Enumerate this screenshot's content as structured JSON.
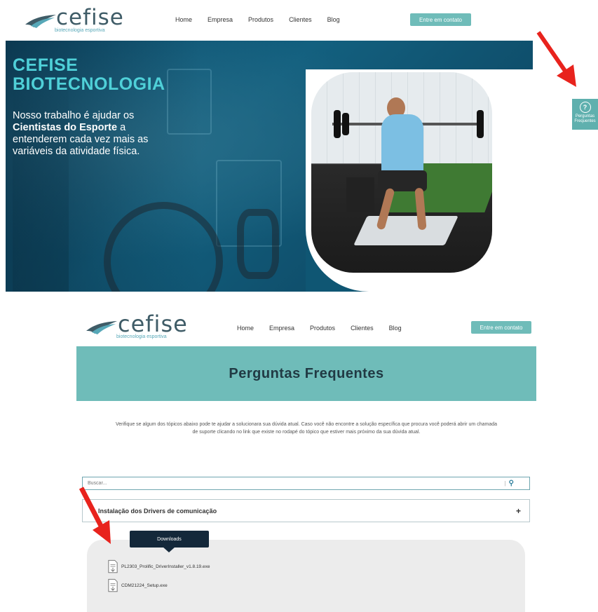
{
  "header": {
    "logo_word": "cefise",
    "logo_tagline": "biotecnologia esportiva",
    "nav": [
      "Home",
      "Empresa",
      "Produtos",
      "Clientes",
      "Blog"
    ],
    "cta_label": "Entre em contato"
  },
  "hero": {
    "title_line1": "CEFISE",
    "title_line2": "BIOTECNOLOGIA",
    "text_part1": "Nosso trabalho é ajudar os",
    "text_bold": "Cientistas do Esporte",
    "text_part2": "a entenderem cada vez mais as variáveis da atividade física."
  },
  "faq_badge": {
    "icon": "question-chat-icon",
    "label_line1": "Perguntas",
    "label_line2": "Frequentes"
  },
  "faq_page": {
    "header": {
      "logo_word": "cefise",
      "logo_tagline": "biotecnologia esportiva",
      "nav": [
        "Home",
        "Empresa",
        "Produtos",
        "Clientes",
        "Blog"
      ],
      "cta_label": "Entre em contato"
    },
    "banner_title": "Perguntas Frequentes",
    "intro_line1": "Verifique se algum dos tópicos abaixo pode te ajudar a solucionara sua dúvida atual. Caso você não encontre a solução específica que procura você poderá abrir um chamada",
    "intro_line2": "de suporte clicando no link que existe no rodapé do tópico que estiver mais próximo da sua dúvida atual.",
    "search_placeholder": "Buscar...",
    "accordion_label": "Instalação dos Drivers de comunicação",
    "accordion_toggle": "+",
    "tooltip": "Downloads",
    "files": [
      "PL2303_Prolific_DriverInstaller_v1.8.19.exe",
      "CDM21224_Setup.exe"
    ]
  },
  "colors": {
    "accent": "#6fbcb9",
    "hero_title": "#4fd0d8",
    "arrow": "#e8231d",
    "tooltip_bg": "#14283a"
  }
}
